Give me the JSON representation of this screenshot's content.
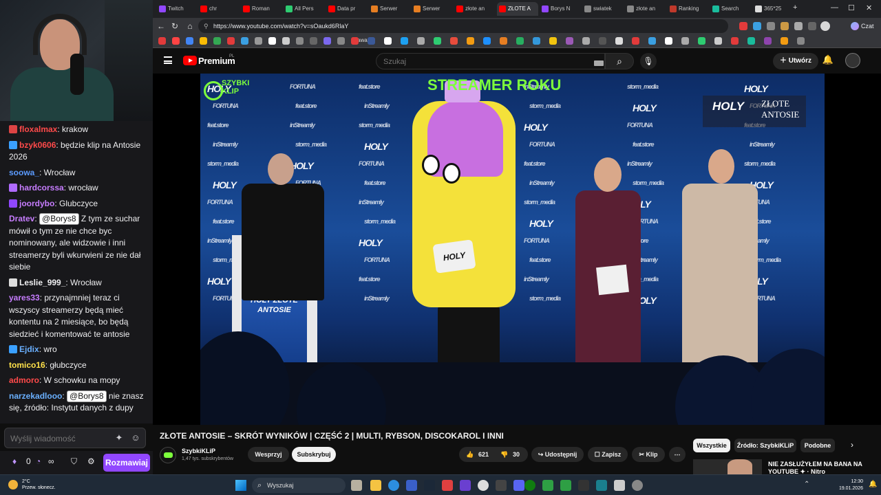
{
  "tabs": [
    {
      "label": "Twitch",
      "color": "#9147ff"
    },
    {
      "label": "chr",
      "color": "#ff0000"
    },
    {
      "label": "Roman",
      "color": "#ff0000"
    },
    {
      "label": "All Pers",
      "color": "#2ecc71"
    },
    {
      "label": "Data pr",
      "color": "#ff0000"
    },
    {
      "label": "Serwer",
      "color": "#e67e22"
    },
    {
      "label": "Serwer",
      "color": "#e67e22"
    },
    {
      "label": "złote an",
      "color": "#ff0000"
    },
    {
      "label": "ZŁOTE A",
      "color": "#ff0000"
    },
    {
      "label": "Borys N",
      "color": "#9147ff"
    },
    {
      "label": "swiatek",
      "color": "#888888"
    },
    {
      "label": "złote an",
      "color": "#888888"
    },
    {
      "label": "Ranking",
      "color": "#c0392b"
    },
    {
      "label": "Search",
      "color": "#1abc9c"
    },
    {
      "label": "365*25",
      "color": "#dddddd"
    }
  ],
  "url": "https://www.youtube.com/watch?v=sOaukd6RlaY",
  "chat_button": "Czat",
  "bookmark_label": "kawa",
  "chat": {
    "messages": [
      {
        "user": "floxalmax",
        "color": "#ff4a4a",
        "badge": "#d44",
        "text": ": krakow"
      },
      {
        "user": "bzyk0606",
        "color": "#ff4a4a",
        "badge": "#3aa0ff",
        "text": ": będzie klip na Antosie 2026"
      },
      {
        "user": "soowa_",
        "color": "#5b9bff",
        "badge": "",
        "text": ": Wrocław"
      },
      {
        "user": "hardcorssa",
        "color": "#c77dff",
        "badge": "#b06bff",
        "text": ": wrocław"
      },
      {
        "user": "joordybo",
        "color": "#c77dff",
        "badge": "#9147ff",
        "text": ": Glubczyce"
      },
      {
        "user": "Dratev",
        "color": "#c77dff",
        "badge": "",
        "mention": "@Borys8",
        "text": " Z tym ze suchar mówił o tym ze nie chce byc nominowany, ale widzowie i inni streamerzy byli wkurwieni ze nie dał siebie"
      },
      {
        "user": "Leslie_999_",
        "color": "#efeff1",
        "badge": "#ddd",
        "text": ": Wrocław"
      },
      {
        "user": "yares33",
        "color": "#c77dff",
        "badge": "",
        "text": ": przynajmniej teraz ci wszyscy streamerzy będą mieć kontentu na 2 miesiące, bo będą siedzieć i komentować te antosie"
      },
      {
        "user": "Ejdix",
        "color": "#6ab0ff",
        "badge": "#3aa0ff",
        "text": ": wro"
      },
      {
        "user": "tomico16",
        "color": "#ffe14a",
        "badge": "",
        "text": ": głubczyce"
      },
      {
        "user": "admoro",
        "color": "#ff4a4a",
        "badge": "",
        "text": ": W schowku na mopy"
      },
      {
        "user": "narzekadlooo",
        "color": "#6ab0ff",
        "badge": "",
        "mention": "@Borys8",
        "text": " nie znasz się, źródło: Instytut danych z dupy"
      }
    ],
    "input_placeholder": "Wyślij wiadomość",
    "points": "0",
    "viewers": "∞",
    "send_label": "Rozmawiaj"
  },
  "youtube": {
    "brand": "Premium",
    "region": "PL",
    "search_placeholder": "Szukaj",
    "create_label": "Utwórz",
    "video": {
      "overlay_top": "STREAMER ROKU",
      "channel_logo_text": "SZYBKI KLIP",
      "overlay_brand": "HOLY",
      "overlay_event": "ZŁOTE ANTOSIE",
      "podium_text": "HOLY ZŁOTE ANTOSIE",
      "label_text": "HOLY",
      "holy_tile": "HOLY",
      "fortuna_tile": "FORTUNA",
      "featstore_tile": "feat.store",
      "instreamly_tile": "inStreamly",
      "storm_tile": "storm_media"
    },
    "title": "ZŁOTE ANTOSIE – SKRÓT WYNIKÓW | CZĘŚĆ 2 | MULTI, RYBSON, DISCOKAROL I INNI",
    "channel": "SzybkiKLiP",
    "subscribers": "1,47 tys. subskrybentów",
    "support_label": "Wesprzyj",
    "subscribe_label": "Subskrybuj",
    "likes": "621",
    "dislikes": "30",
    "share_label": "Udostępnij",
    "save_label": "Zapisz",
    "clip_label": "Klip",
    "chips": [
      "Wszystkie",
      "Źródło: SzybkiKLiP",
      "Podobne"
    ],
    "recommended_title": "NIE ZASŁUŻYŁEM NA BANA NA YOUTUBE ✦ · Nitro"
  },
  "taskbar": {
    "temperature": "2°C",
    "weather": "Przew. słonecz.",
    "search": "Wyszukaj",
    "time": "12:30",
    "date": "19.01.2026"
  }
}
